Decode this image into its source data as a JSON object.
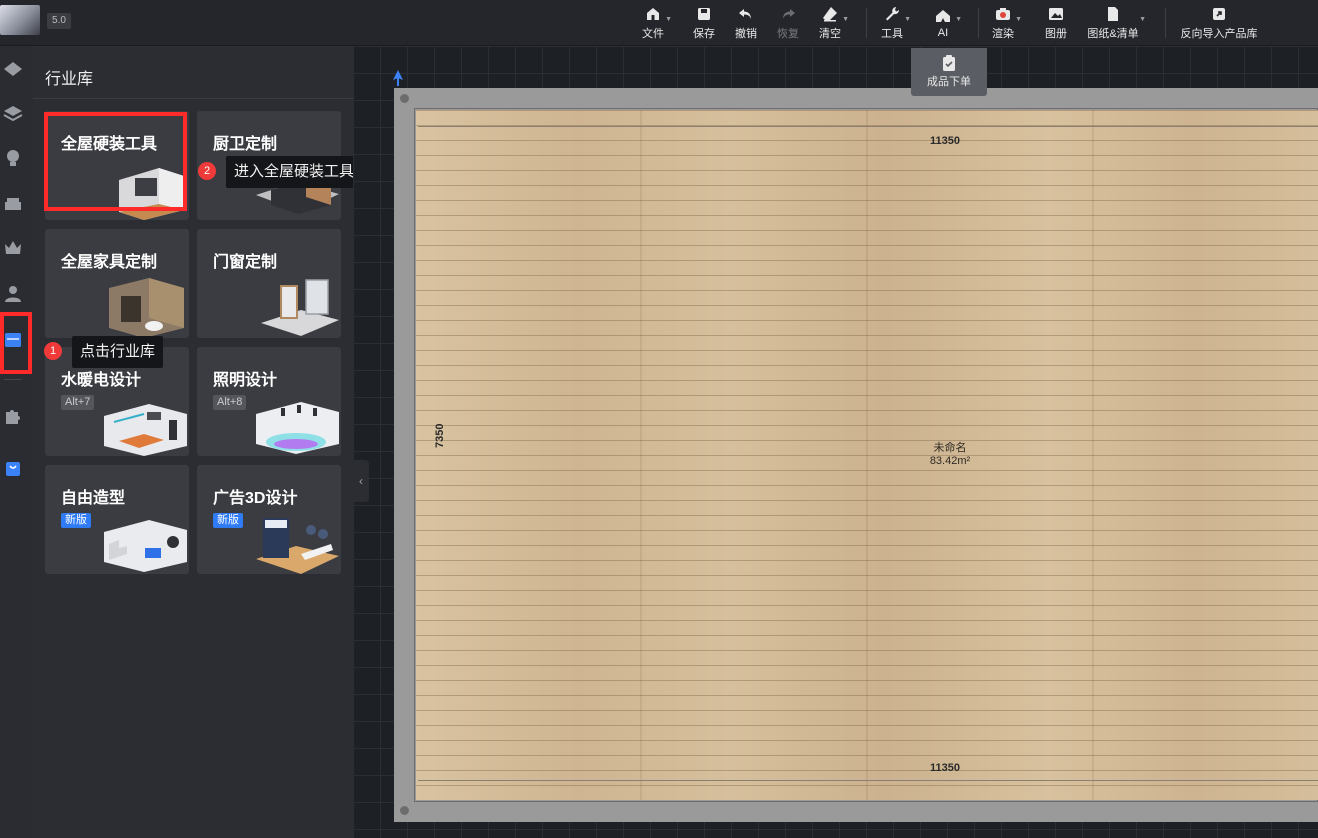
{
  "app": {
    "version": "5.0"
  },
  "toolbar": {
    "file": "文件",
    "save": "保存",
    "undo": "撤销",
    "redo": "恢复",
    "clear": "清空",
    "tools": "工具",
    "ai": "AI",
    "render": "渲染",
    "album": "图册",
    "drawings": "图纸&清单",
    "reverse_import": "反向导入产品库"
  },
  "panel": {
    "title": "行业库",
    "cards": [
      {
        "title": "全屋硬装工具",
        "badge": "",
        "badge_type": ""
      },
      {
        "title": "厨卫定制",
        "badge": "",
        "badge_type": ""
      },
      {
        "title": "全屋家具定制",
        "badge": "",
        "badge_type": ""
      },
      {
        "title": "门窗定制",
        "badge": "",
        "badge_type": ""
      },
      {
        "title": "水暖电设计",
        "badge": "Alt+7",
        "badge_type": "key"
      },
      {
        "title": "照明设计",
        "badge": "Alt+8",
        "badge_type": "key"
      },
      {
        "title": "自由造型",
        "badge": "新版",
        "badge_type": "new"
      },
      {
        "title": "广告3D设计",
        "badge": "新版",
        "badge_type": "new"
      }
    ]
  },
  "annotations": {
    "step1": {
      "num": "1",
      "text": "点击行业库"
    },
    "step2": {
      "num": "2",
      "text": "进入全屋硬装工具"
    }
  },
  "canvas": {
    "order_button": "成品下单",
    "width_label": "11350",
    "height_label": "7350",
    "room_name": "未命名",
    "room_area": "83.42m²"
  },
  "colors": {
    "highlight": "#ff2a2a",
    "step_badge": "#f03a3a",
    "new_badge": "#2f7bf5"
  }
}
